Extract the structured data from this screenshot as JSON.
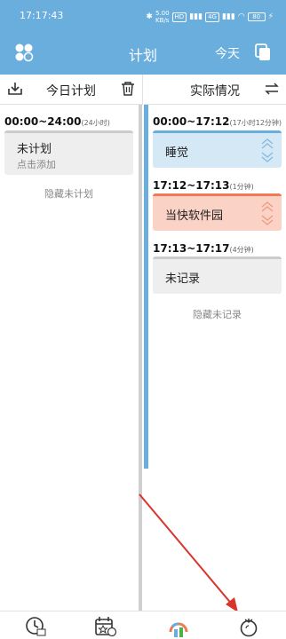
{
  "status_bar": {
    "time": "17:17:43",
    "network_speed": "5.00",
    "network_unit": "KB/s",
    "net1": "4G",
    "net2": "HD",
    "battery": "80"
  },
  "app_bar": {
    "title": "计划",
    "today_label": "今天",
    "menu_icon": "grid-menu-icon",
    "copy_icon": "copy-icon"
  },
  "left_panel": {
    "toolbar": {
      "download_icon": "download-icon",
      "title": "今日计划",
      "trash_icon": "trash-icon"
    },
    "blocks": [
      {
        "range": "00:00~24:00",
        "duration": "(24小时)",
        "name": "未计划",
        "sub": "点击添加"
      }
    ],
    "hint": "隐藏未计划"
  },
  "right_panel": {
    "toolbar": {
      "title": "实际情况",
      "swap_icon": "swap-icon"
    },
    "blocks": [
      {
        "range": "00:00~17:12",
        "duration": "(17小时12分钟)",
        "name": "睡觉",
        "color": "#d5e8f6",
        "accent": "#6aaede"
      },
      {
        "range": "17:12~17:13",
        "duration": "(1分钟)",
        "name": "当快软件园",
        "color": "#fbd3c6",
        "accent": "#f07a52"
      },
      {
        "range": "17:13~17:17",
        "duration": "(4分钟)",
        "name": "未记录",
        "color": "#eeeeee",
        "accent": "#cccccc"
      }
    ],
    "hint": "隐藏未记录"
  },
  "bottom_nav": [
    {
      "icon": "clock-icon"
    },
    {
      "icon": "calendar-star-icon"
    },
    {
      "icon": "chart-icon"
    },
    {
      "icon": "tomato-icon"
    }
  ],
  "colors": {
    "primary": "#6aaede",
    "accent_orange": "#f07a52",
    "arrow": "#d9342b"
  }
}
